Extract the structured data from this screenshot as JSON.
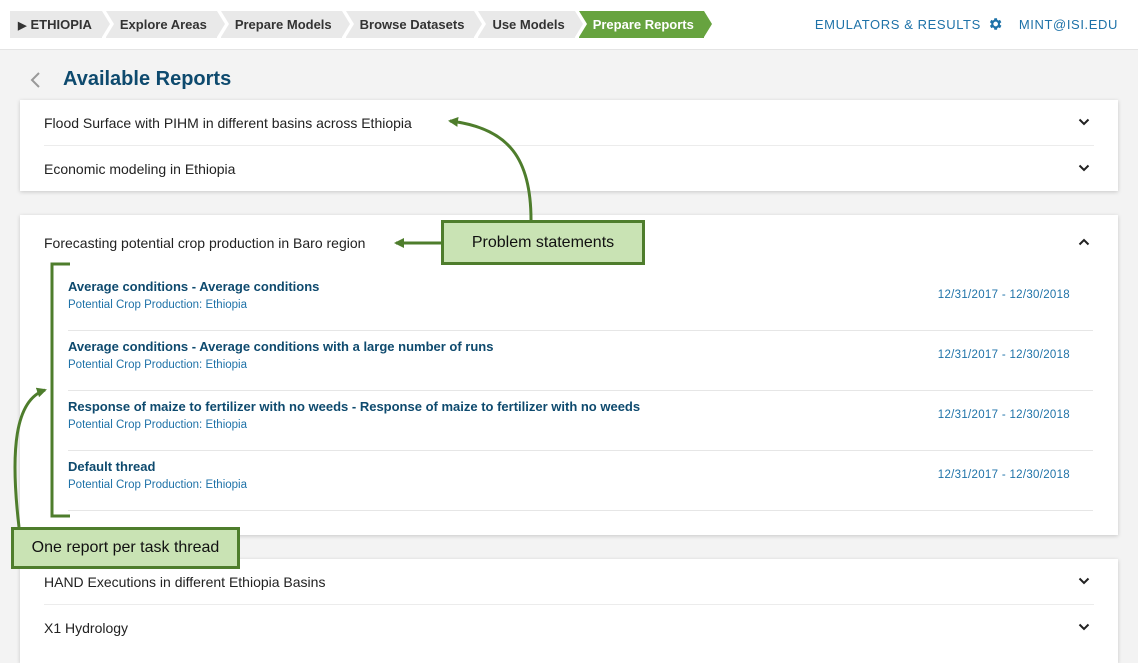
{
  "nav": {
    "crumbs": [
      {
        "label": "ETHIOPIA"
      },
      {
        "label": "Explore Areas"
      },
      {
        "label": "Prepare Models"
      },
      {
        "label": "Browse Datasets"
      },
      {
        "label": "Use Models"
      },
      {
        "label": "Prepare Reports"
      }
    ],
    "active_index": 5,
    "emulators_label": "EMULATORS & RESULTS",
    "user_label": "MINT@ISI.EDU",
    "settings_icon": "gear-icon"
  },
  "page": {
    "title": "Available Reports",
    "back_icon": "chevron-left-icon"
  },
  "problems": {
    "group1": [
      "Flood Surface with PIHM in different basins across Ethiopia",
      "Economic modeling in Ethiopia"
    ],
    "expanded": {
      "label": "Forecasting potential crop production in Baro region",
      "threads": [
        {
          "name": "Average conditions - Average conditions",
          "sub": "Potential Crop Production: Ethiopia",
          "dates": "12/31/2017 - 12/30/2018"
        },
        {
          "name": "Average conditions - Average conditions with a large number of runs",
          "sub": "Potential Crop Production: Ethiopia",
          "dates": "12/31/2017 - 12/30/2018"
        },
        {
          "name": "Response of maize to fertilizer with no weeds - Response of maize to fertilizer with no weeds",
          "sub": "Potential Crop Production: Ethiopia",
          "dates": "12/31/2017 - 12/30/2018"
        },
        {
          "name": "Default thread",
          "sub": "Potential Crop Production: Ethiopia",
          "dates": "12/31/2017 - 12/30/2018"
        }
      ]
    },
    "group3": [
      "HAND Executions in different Ethiopia Basins",
      "X1 Hydrology"
    ]
  },
  "annotations": {
    "problem_statements": "Problem statements",
    "one_report": "One report per task thread"
  },
  "colors": {
    "active_crumb": "#67a33f",
    "link_blue": "#1e72a8",
    "title_navy": "#0e4a6e",
    "annotation_fill": "#c9e3b4",
    "annotation_stroke": "#4e7d2c"
  }
}
